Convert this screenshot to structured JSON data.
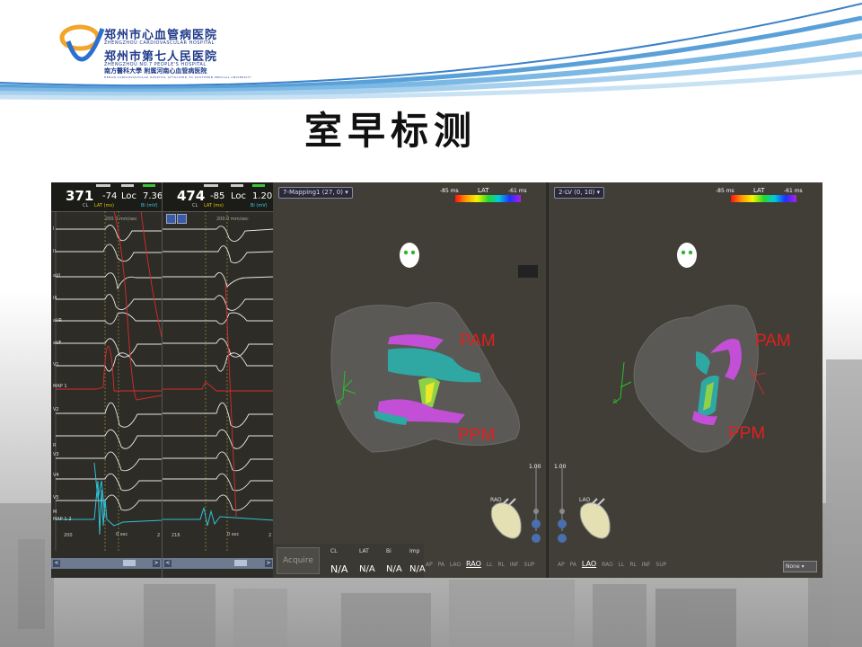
{
  "header": {
    "hospital_cn_1": "郑州市心血管病医院",
    "hospital_en_1": "ZHENGZHOU CARDIOVASCULAR HOSPITAL",
    "hospital_cn_2": "郑州市第七人民医院",
    "hospital_en_2": "ZHENGZHOU NO.7 PEOPLE'S HOSPITAL",
    "hospital_cn_3": "南方醫科大學 附属河南心血管病医院",
    "hospital_en_3": "HENAN CARDIOVASCULAR HOSPITAL AFFILIATED TO SOUTHERN MEDICAL UNIVERSITY"
  },
  "slide": {
    "title": "室早标测"
  },
  "ecg1": {
    "cl": "371",
    "lat": "-74",
    "loc": "Loc",
    "bi": "7.36",
    "cl_label": "CL",
    "lat_label": "LAT (ms)",
    "bi_label": "Bi (mV)",
    "speed": "200.0 mm/sec",
    "time_left": "200",
    "time_mid": "0 sec",
    "time_right": "2"
  },
  "ecg2": {
    "cl": "474",
    "lat": "-85",
    "loc": "Loc",
    "bi": "1.20",
    "cl_label": "CL",
    "lat_label": "LAT (ms)",
    "bi_label": "Bi (mV)",
    "speed": "200.0 mm/sec",
    "time_left": "216",
    "time_mid": "0 sec",
    "time_right": "2"
  },
  "leads": [
    "I",
    "II",
    "aVL",
    "III",
    "aVR",
    "aVF",
    "V1",
    "MAP 1",
    "V2",
    "R",
    "V3",
    "V4",
    "V5",
    "V6",
    "M",
    "MAP 1-2"
  ],
  "map1": {
    "selector": "7-Mapping1 (27, 0)",
    "lat_title": "LAT",
    "lat_min": "-85 ms",
    "lat_max": "-61 ms",
    "label_top": "PAM",
    "label_bottom": "PPM",
    "axis_label": "R",
    "orient_label": "RAO",
    "zoom": "1.00",
    "views": [
      "AP",
      "PA",
      "LAO",
      "RAO",
      "LL",
      "RL",
      "INF",
      "SUP"
    ],
    "active_view": "RAO"
  },
  "map2": {
    "selector": "2-LV (0, 10)",
    "lat_title": "LAT",
    "lat_min": "-85 ms",
    "lat_max": "-61 ms",
    "label_top": "PAM",
    "label_bottom": "PPM",
    "axis_label": "R",
    "orient_label": "LAO",
    "zoom": "1.00",
    "views": [
      "AP",
      "PA",
      "LAO",
      "RAO",
      "LL",
      "RL",
      "INF",
      "SUP"
    ],
    "active_view": "LAO",
    "display_select": "None"
  },
  "point_stats": {
    "acquire_label": "Acquire",
    "cl_label": "CL",
    "lat_label": "LAT",
    "bi_label": "Bi",
    "imp_label": "Imp",
    "cl_value": "N/A",
    "lat_value": "N/A",
    "bi_value": "N/A",
    "imp_value": "N/A"
  },
  "colors": {
    "header_blue": "#1f3a8a",
    "lat_label_red": "#e02020",
    "pam_magenta": "#c34fd6",
    "ppm_teal": "#2fa7a3",
    "ecg_trace_red": "#d92b2b",
    "ecg_trace_cyan": "#2fc2d6"
  }
}
